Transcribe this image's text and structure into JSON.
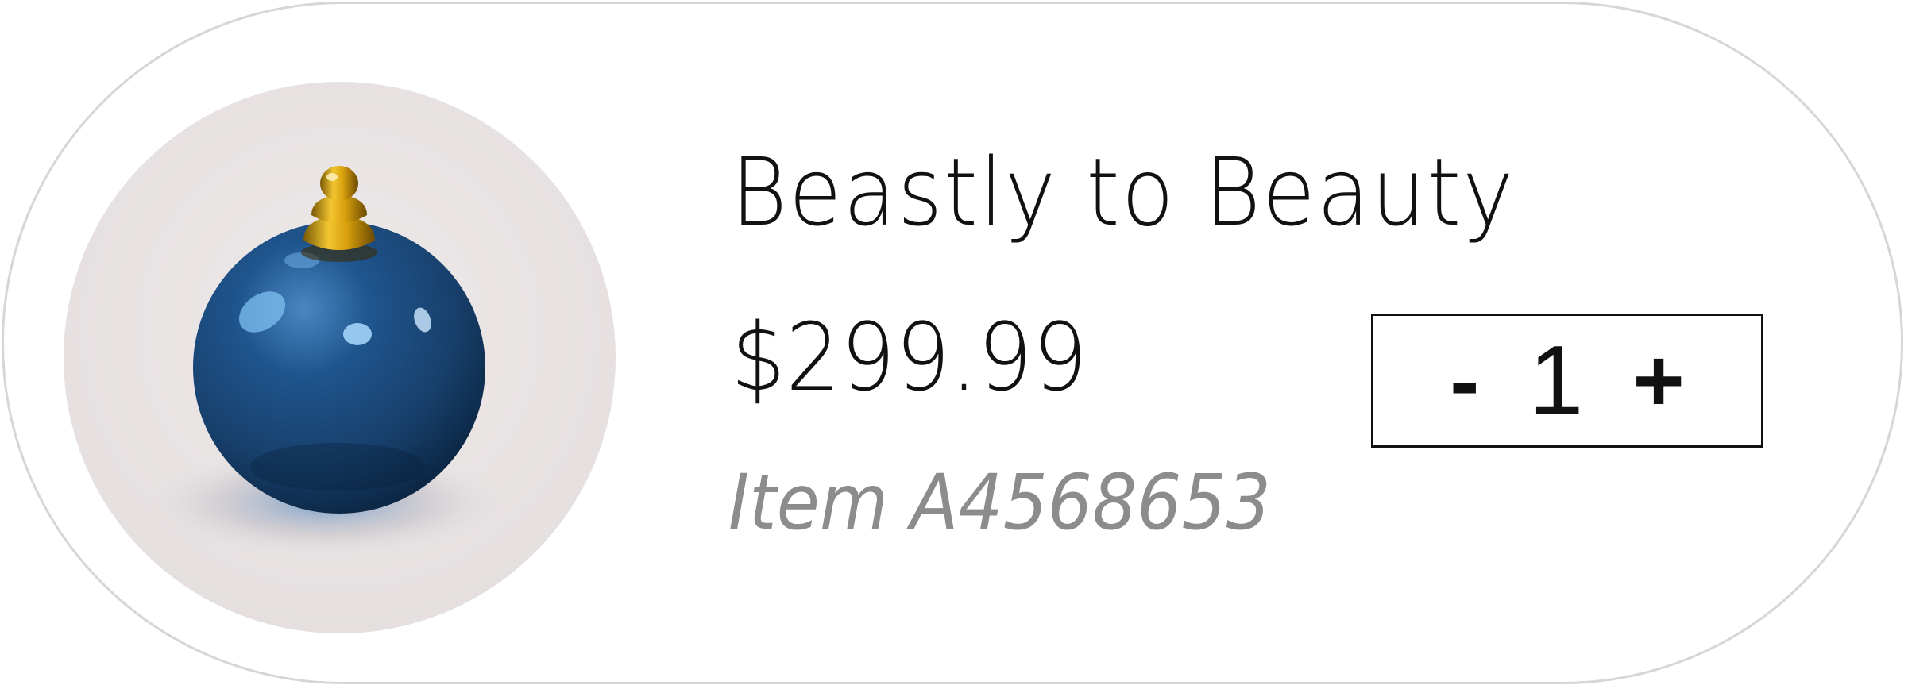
{
  "product": {
    "title": "Beastly to Beauty",
    "price": "$299.99",
    "item_number": "Item A4568653",
    "image_icon": "ornament-bauble-image"
  },
  "quantity": {
    "decrement_label": "-",
    "value": "1",
    "increment_label": "+"
  },
  "colors": {
    "card_border": "#d6d6d6",
    "text": "#111111",
    "muted_text": "#8c8c8c",
    "photo_background": "#e8e3e4",
    "ornament": "#1d4a7c",
    "cap": "#d4a20a"
  }
}
